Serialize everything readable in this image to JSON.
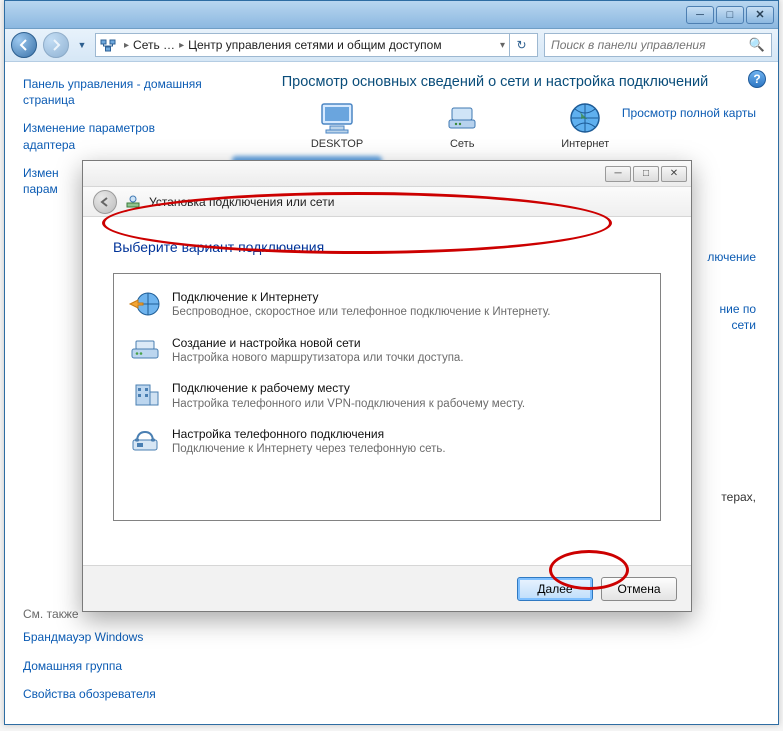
{
  "outer": {
    "breadcrumb": {
      "seg1": "Сеть …",
      "seg2": "Центр управления сетями и общим доступом"
    },
    "search_placeholder": "Поиск в панели управления"
  },
  "left": {
    "link1": "Панель управления - домашняя страница",
    "link2": "Изменение параметров адаптера",
    "link3_a": "Измен",
    "link3_b": "парам",
    "see_also": "См. также",
    "link4": "Брандмауэр Windows",
    "link5": "Домашняя группа",
    "link6": "Свойства обозревателя"
  },
  "main": {
    "heading": "Просмотр основных сведений о сети и настройка подключений",
    "map_link": "Просмотр полной карты",
    "node1": "DESKTOP",
    "node2": "Сеть",
    "node3": "Интернет",
    "right2": "лючение",
    "right3": "ние по\nсети",
    "bottom1": "терах,"
  },
  "wizard": {
    "header_title": "Установка подключения или сети",
    "instruction": "Выберите вариант подключения",
    "options": [
      {
        "title": "Подключение к Интернету",
        "desc": "Беспроводное, скоростное или телефонное подключение к Интернету."
      },
      {
        "title": "Создание и настройка новой сети",
        "desc": "Настройка нового маршрутизатора или точки доступа."
      },
      {
        "title": "Подключение к рабочему месту",
        "desc": "Настройка телефонного или VPN-подключения к рабочему месту."
      },
      {
        "title": "Настройка телефонного подключения",
        "desc": "Подключение к Интернету через телефонную сеть."
      }
    ],
    "btn_next": "Далее",
    "btn_cancel": "Отмена"
  }
}
